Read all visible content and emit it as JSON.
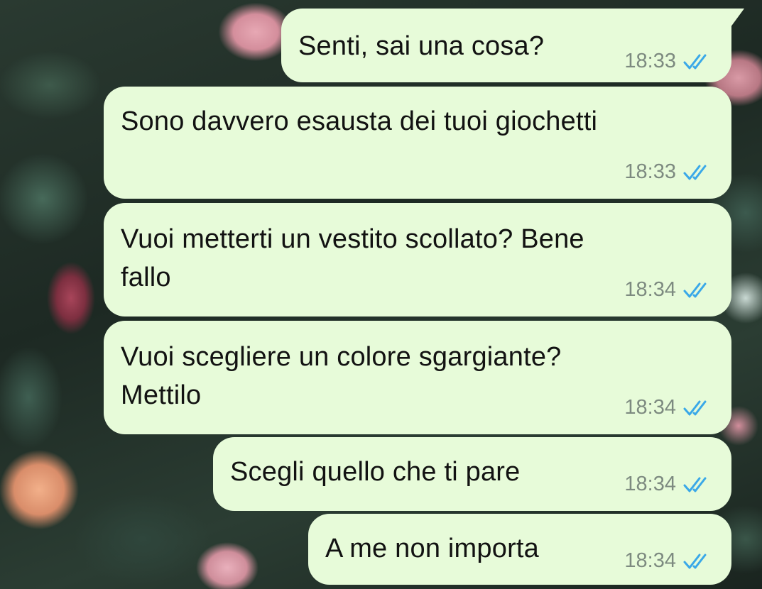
{
  "colors": {
    "outgoing_bubble": "#e7fbd9",
    "timestamp": "#7d8a80",
    "read_check": "#3aa8e8"
  },
  "messages": [
    {
      "text": "Senti, sai una cosa?",
      "time": "18:33",
      "status_icon": "double-check-read-icon"
    },
    {
      "text": "Sono davvero esausta dei tuoi giochetti",
      "time": "18:33",
      "status_icon": "double-check-read-icon"
    },
    {
      "text": "Vuoi metterti un vestito scollato? Bene\nfallo",
      "time": "18:34",
      "status_icon": "double-check-read-icon"
    },
    {
      "text": "Vuoi scegliere un colore sgargiante?\nMettilo",
      "time": "18:34",
      "status_icon": "double-check-read-icon"
    },
    {
      "text": "Scegli quello che ti pare",
      "time": "18:34",
      "status_icon": "double-check-read-icon"
    },
    {
      "text": "A me non importa",
      "time": "18:34",
      "status_icon": "double-check-read-icon"
    }
  ]
}
